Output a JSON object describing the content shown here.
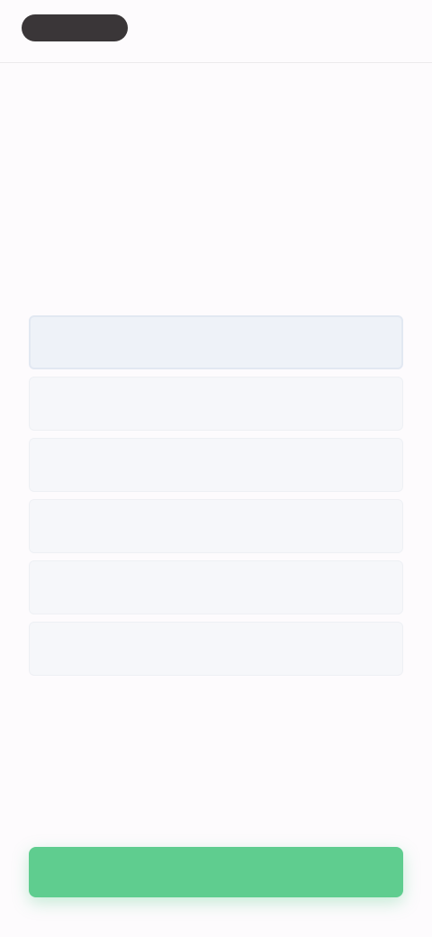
{
  "header": {
    "logo_text": "",
    "top_link": ""
  },
  "eyebrow": "",
  "heading": "",
  "subtitle": "",
  "options": [
    {
      "label": ""
    },
    {
      "label": ""
    },
    {
      "label": ""
    },
    {
      "label": ""
    },
    {
      "label": ""
    },
    {
      "label": ""
    }
  ],
  "cta": {
    "label": ""
  },
  "colors": {
    "accent": "#5fcd8f",
    "logo_bg": "#3a3638",
    "option_bg": "#f6f7fa",
    "selected_border": "#e2e8f2"
  }
}
